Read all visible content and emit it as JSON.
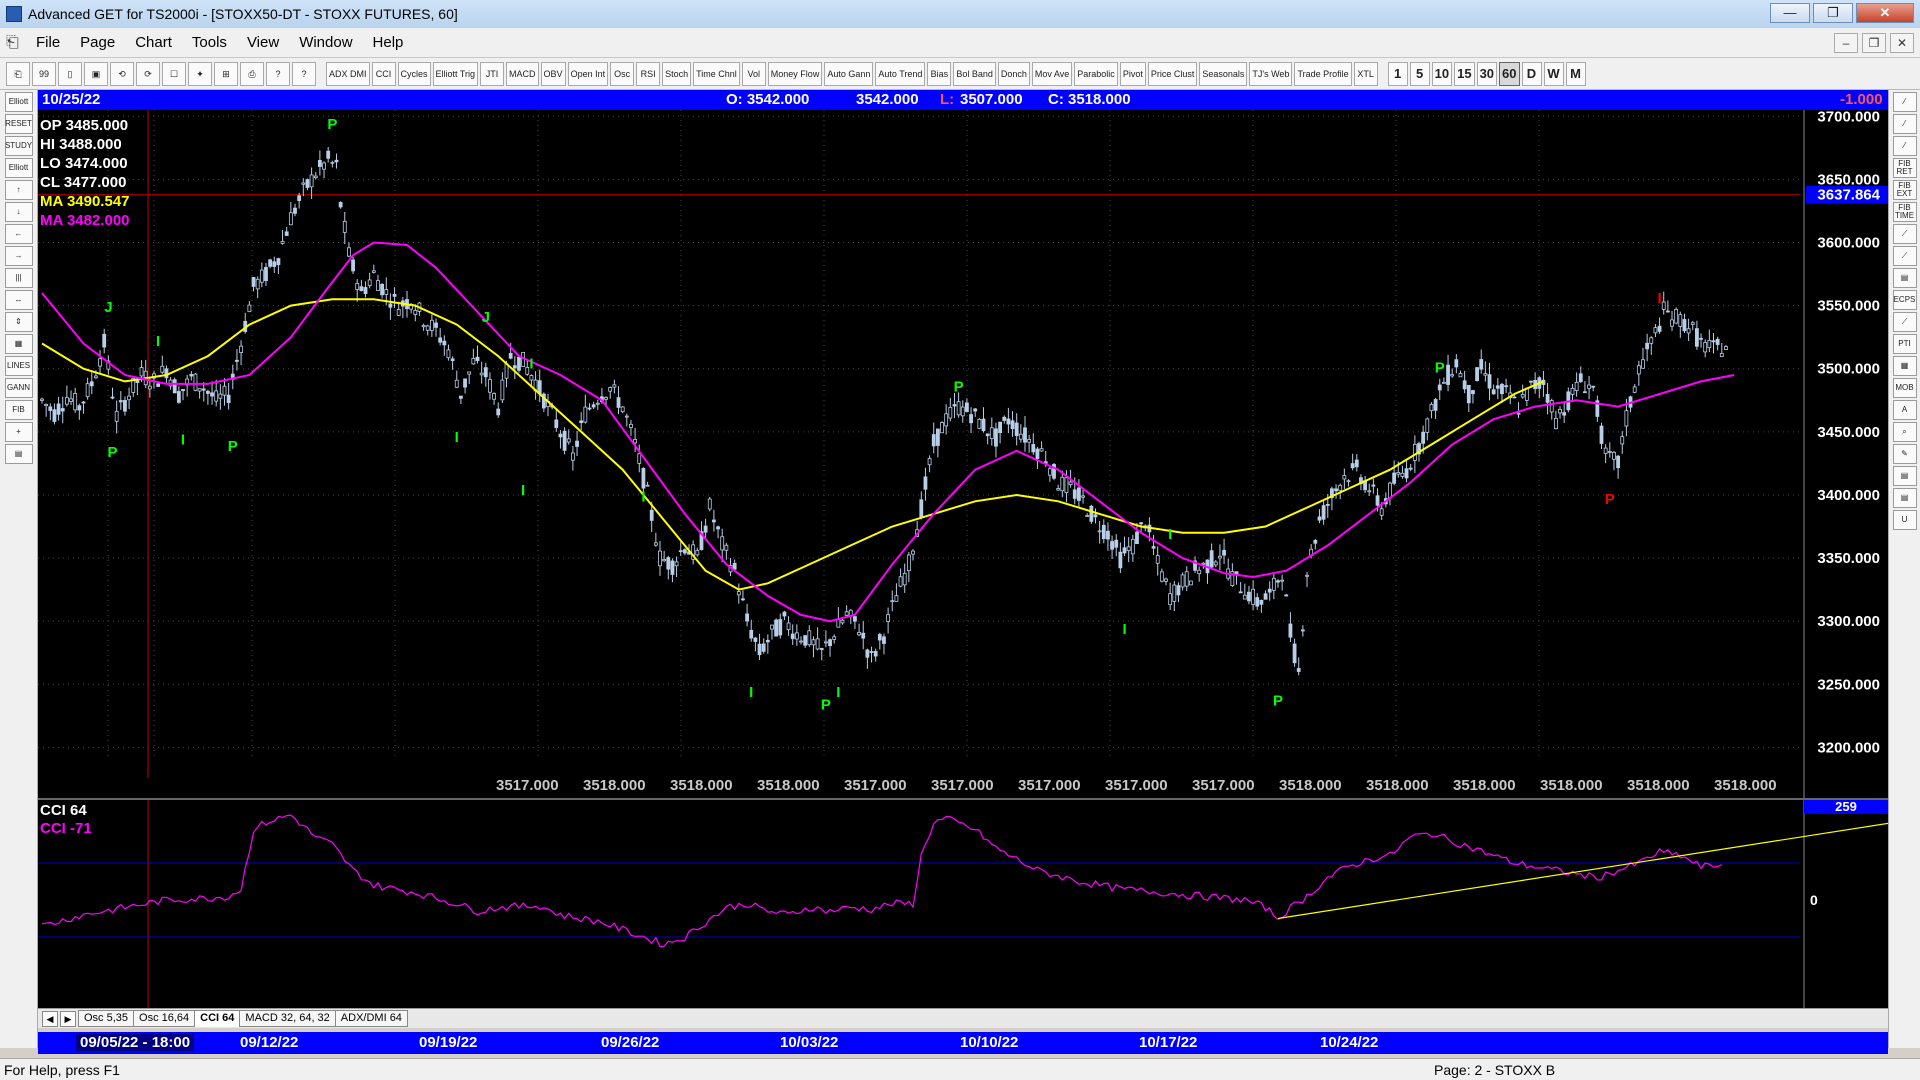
{
  "window": {
    "title": "Advanced GET for TS2000i - [STOXX50-DT - STOXX FUTURES, 60]",
    "minimize": "—",
    "maximize": "❐",
    "close": "✕"
  },
  "menu": [
    "File",
    "Page",
    "Chart",
    "Tools",
    "View",
    "Window",
    "Help"
  ],
  "mdi_buttons": [
    "–",
    "❐",
    "✕"
  ],
  "toolbar": {
    "file_buttons": [
      "⎗",
      "99",
      "▯",
      "▣",
      "⟲",
      "⟳",
      "☐",
      "✦",
      "⊞",
      "⎙",
      "?",
      "?"
    ],
    "studies": [
      "ADX DMI",
      "CCI",
      "Cycles",
      "Elliott Trig",
      "JTI",
      "MACD",
      "OBV",
      "Open Int",
      "Osc",
      "RSI",
      "Stoch",
      "Time Chnl",
      "Vol",
      "Money Flow",
      "Auto Gann",
      "Auto Trend",
      "Bias",
      "Bol Band",
      "Donch",
      "Mov Ave",
      "Parabolic",
      "Pivot",
      "Price Clust",
      "Seasonals",
      "TJ's Web",
      "Trade Profile",
      "XTL"
    ],
    "periods": [
      "1",
      "5",
      "10",
      "15",
      "30",
      "60",
      "D",
      "W",
      "M"
    ],
    "active_period": "60"
  },
  "left_tools": [
    "Elliott",
    "RESET",
    "STUDY",
    "Elliott",
    "↑",
    "↓",
    "←",
    "→",
    "|||",
    "↔",
    "⇕",
    "▦",
    "LINES",
    "GANN",
    "FIB",
    "+",
    "▤"
  ],
  "right_tools": [
    "⁄",
    "⁄",
    "⁄",
    "FIB RET",
    "FIB EXT",
    "FIB TIME",
    "⟋",
    "⟋",
    "▤",
    "ECPS",
    "⟋",
    "PTI",
    "▦",
    "MOB",
    "A",
    "⌕",
    "✎",
    "▤",
    "▤",
    "U"
  ],
  "infobar": {
    "date": "10/25/22",
    "open": "O: 3542.000",
    "high": "3542.000",
    "low_label": "L:",
    "low": "3507.000",
    "close": "C: 3518.000",
    "change": "-1.000"
  },
  "chart_data": {
    "type": "candlestick",
    "symbol": "STOXX50-DT",
    "interval": "60",
    "ylim": [
      3190,
      3705
    ],
    "yticks": [
      "3700.000",
      "3650.000",
      "3600.000",
      "3550.000",
      "3500.000",
      "3450.000",
      "3400.000",
      "3350.000",
      "3300.000",
      "3250.000",
      "3200.000"
    ],
    "hline": {
      "value": 3637.864,
      "label": "3637.864"
    },
    "legend": [
      {
        "key": "OP",
        "value": "3485.000",
        "color": "#ffffff"
      },
      {
        "key": "HI",
        "value": "3488.000",
        "color": "#ffffff"
      },
      {
        "key": "LO",
        "value": "3474.000",
        "color": "#ffffff"
      },
      {
        "key": "CL",
        "value": "3477.000",
        "color": "#ffffff"
      },
      {
        "key": "MA",
        "value": "3490.547",
        "color": "#ffff00"
      },
      {
        "key": "MA",
        "value": "3482.000",
        "color": "#ff00ff"
      }
    ],
    "price_path": [
      [
        0,
        3475
      ],
      [
        3,
        3465
      ],
      [
        6,
        3478
      ],
      [
        9,
        3470
      ],
      [
        12,
        3488
      ],
      [
        15,
        3520
      ],
      [
        18,
        3462
      ],
      [
        21,
        3480
      ],
      [
        24,
        3495
      ],
      [
        27,
        3490
      ],
      [
        30,
        3500
      ],
      [
        33,
        3480
      ],
      [
        36,
        3492
      ],
      [
        39,
        3485
      ],
      [
        42,
        3475
      ],
      [
        45,
        3480
      ],
      [
        48,
        3520
      ],
      [
        51,
        3565
      ],
      [
        54,
        3575
      ],
      [
        57,
        3590
      ],
      [
        60,
        3620
      ],
      [
        63,
        3640
      ],
      [
        66,
        3655
      ],
      [
        69,
        3665
      ],
      [
        71,
        3660
      ],
      [
        72,
        3630
      ],
      [
        74,
        3590
      ],
      [
        77,
        3560
      ],
      [
        80,
        3575
      ],
      [
        83,
        3560
      ],
      [
        86,
        3550
      ],
      [
        89,
        3555
      ],
      [
        92,
        3540
      ],
      [
        95,
        3530
      ],
      [
        98,
        3515
      ],
      [
        101,
        3480
      ],
      [
        104,
        3505
      ],
      [
        107,
        3495
      ],
      [
        110,
        3470
      ],
      [
        113,
        3510
      ],
      [
        116,
        3505
      ],
      [
        119,
        3490
      ],
      [
        122,
        3470
      ],
      [
        125,
        3450
      ],
      [
        128,
        3430
      ],
      [
        131,
        3465
      ],
      [
        134,
        3478
      ],
      [
        137,
        3485
      ],
      [
        140,
        3470
      ],
      [
        143,
        3440
      ],
      [
        146,
        3400
      ],
      [
        149,
        3350
      ],
      [
        152,
        3345
      ],
      [
        155,
        3360
      ],
      [
        158,
        3350
      ],
      [
        161,
        3390
      ],
      [
        164,
        3360
      ],
      [
        167,
        3340
      ],
      [
        170,
        3300
      ],
      [
        173,
        3275
      ],
      [
        176,
        3290
      ],
      [
        179,
        3300
      ],
      [
        182,
        3290
      ],
      [
        185,
        3285
      ],
      [
        188,
        3275
      ],
      [
        191,
        3290
      ],
      [
        194,
        3305
      ],
      [
        197,
        3295
      ],
      [
        200,
        3270
      ],
      [
        203,
        3290
      ],
      [
        206,
        3320
      ],
      [
        209,
        3345
      ],
      [
        212,
        3390
      ],
      [
        215,
        3440
      ],
      [
        218,
        3460
      ],
      [
        221,
        3470
      ],
      [
        224,
        3465
      ],
      [
        227,
        3455
      ],
      [
        230,
        3445
      ],
      [
        233,
        3460
      ],
      [
        236,
        3450
      ],
      [
        239,
        3440
      ],
      [
        242,
        3430
      ],
      [
        245,
        3410
      ],
      [
        248,
        3405
      ],
      [
        251,
        3395
      ],
      [
        254,
        3380
      ],
      [
        257,
        3370
      ],
      [
        260,
        3350
      ],
      [
        263,
        3360
      ],
      [
        266,
        3380
      ],
      [
        269,
        3345
      ],
      [
        272,
        3320
      ],
      [
        275,
        3330
      ],
      [
        278,
        3340
      ],
      [
        281,
        3345
      ],
      [
        284,
        3355
      ],
      [
        287,
        3335
      ],
      [
        290,
        3325
      ],
      [
        293,
        3315
      ],
      [
        296,
        3320
      ],
      [
        299,
        3340
      ],
      [
        301,
        3290
      ],
      [
        303,
        3260
      ],
      [
        305,
        3340
      ],
      [
        308,
        3380
      ],
      [
        311,
        3400
      ],
      [
        314,
        3415
      ],
      [
        317,
        3420
      ],
      [
        320,
        3405
      ],
      [
        323,
        3390
      ],
      [
        326,
        3410
      ],
      [
        329,
        3420
      ],
      [
        332,
        3440
      ],
      [
        335,
        3465
      ],
      [
        338,
        3490
      ],
      [
        341,
        3505
      ],
      [
        344,
        3480
      ],
      [
        347,
        3500
      ],
      [
        350,
        3485
      ],
      [
        353,
        3480
      ],
      [
        356,
        3470
      ],
      [
        359,
        3485
      ],
      [
        362,
        3490
      ],
      [
        365,
        3460
      ],
      [
        368,
        3475
      ],
      [
        371,
        3490
      ],
      [
        374,
        3485
      ],
      [
        377,
        3430
      ],
      [
        380,
        3425
      ],
      [
        382,
        3460
      ],
      [
        385,
        3500
      ],
      [
        388,
        3520
      ],
      [
        391,
        3545
      ],
      [
        394,
        3540
      ],
      [
        397,
        3535
      ],
      [
        400,
        3520
      ],
      [
        403,
        3515
      ],
      [
        406,
        3518
      ]
    ],
    "ma_yellow": [
      [
        0,
        3520
      ],
      [
        10,
        3500
      ],
      [
        20,
        3490
      ],
      [
        30,
        3495
      ],
      [
        40,
        3510
      ],
      [
        50,
        3535
      ],
      [
        60,
        3550
      ],
      [
        70,
        3555
      ],
      [
        80,
        3555
      ],
      [
        90,
        3550
      ],
      [
        100,
        3535
      ],
      [
        110,
        3510
      ],
      [
        120,
        3480
      ],
      [
        130,
        3450
      ],
      [
        140,
        3420
      ],
      [
        150,
        3380
      ],
      [
        160,
        3340
      ],
      [
        168,
        3325
      ],
      [
        175,
        3330
      ],
      [
        185,
        3345
      ],
      [
        195,
        3360
      ],
      [
        205,
        3375
      ],
      [
        215,
        3385
      ],
      [
        225,
        3395
      ],
      [
        235,
        3400
      ],
      [
        245,
        3395
      ],
      [
        255,
        3385
      ],
      [
        265,
        3375
      ],
      [
        275,
        3370
      ],
      [
        285,
        3370
      ],
      [
        295,
        3375
      ],
      [
        305,
        3390
      ],
      [
        315,
        3405
      ],
      [
        325,
        3420
      ],
      [
        335,
        3440
      ],
      [
        345,
        3460
      ],
      [
        355,
        3480
      ],
      [
        362,
        3490
      ]
    ],
    "ma_magenta": [
      [
        0,
        3560
      ],
      [
        10,
        3520
      ],
      [
        20,
        3495
      ],
      [
        30,
        3488
      ],
      [
        40,
        3488
      ],
      [
        50,
        3495
      ],
      [
        60,
        3525
      ],
      [
        68,
        3560
      ],
      [
        75,
        3590
      ],
      [
        80,
        3600
      ],
      [
        88,
        3598
      ],
      [
        95,
        3580
      ],
      [
        105,
        3545
      ],
      [
        115,
        3510
      ],
      [
        125,
        3495
      ],
      [
        135,
        3475
      ],
      [
        145,
        3430
      ],
      [
        155,
        3385
      ],
      [
        165,
        3345
      ],
      [
        175,
        3320
      ],
      [
        183,
        3305
      ],
      [
        190,
        3300
      ],
      [
        196,
        3305
      ],
      [
        205,
        3345
      ],
      [
        215,
        3385
      ],
      [
        225,
        3420
      ],
      [
        235,
        3435
      ],
      [
        245,
        3420
      ],
      [
        255,
        3395
      ],
      [
        265,
        3370
      ],
      [
        275,
        3350
      ],
      [
        285,
        3338
      ],
      [
        292,
        3335
      ],
      [
        300,
        3340
      ],
      [
        310,
        3360
      ],
      [
        320,
        3385
      ],
      [
        330,
        3410
      ],
      [
        340,
        3440
      ],
      [
        350,
        3460
      ],
      [
        360,
        3470
      ],
      [
        370,
        3475
      ],
      [
        380,
        3470
      ],
      [
        390,
        3480
      ],
      [
        400,
        3490
      ],
      [
        408,
        3495
      ]
    ],
    "cycle_labels": [
      {
        "t": "J",
        "i": 16,
        "p": 3545,
        "color": "#00ff00"
      },
      {
        "t": "P",
        "i": 17,
        "p": 3430,
        "color": "#00ff00"
      },
      {
        "t": "I",
        "i": 28,
        "p": 3518,
        "color": "#00ff00"
      },
      {
        "t": "I",
        "i": 34,
        "p": 3440,
        "color": "#00ff00"
      },
      {
        "t": "P",
        "i": 46,
        "p": 3435,
        "color": "#00ff00"
      },
      {
        "t": "P",
        "i": 70,
        "p": 3690,
        "color": "#00ff00"
      },
      {
        "t": "J",
        "i": 107,
        "p": 3537,
        "color": "#00ff00"
      },
      {
        "t": "I",
        "i": 100,
        "p": 3442,
        "color": "#00ff00"
      },
      {
        "t": "I",
        "i": 118,
        "p": 3500,
        "color": "#00ff00"
      },
      {
        "t": "I",
        "i": 116,
        "p": 3400,
        "color": "#00ff00"
      },
      {
        "t": "I",
        "i": 145,
        "p": 3395,
        "color": "#00ff00"
      },
      {
        "t": "I",
        "i": 171,
        "p": 3240,
        "color": "#00ff00"
      },
      {
        "t": "P",
        "i": 189,
        "p": 3230,
        "color": "#00ff00"
      },
      {
        "t": "I",
        "i": 192,
        "p": 3240,
        "color": "#00ff00"
      },
      {
        "t": "P",
        "i": 221,
        "p": 3482,
        "color": "#00ff00"
      },
      {
        "t": "I",
        "i": 261,
        "p": 3290,
        "color": "#00ff00"
      },
      {
        "t": "I",
        "i": 272,
        "p": 3365,
        "color": "#00ff00"
      },
      {
        "t": "P",
        "i": 298,
        "p": 3233,
        "color": "#00ff00"
      },
      {
        "t": "P",
        "i": 337,
        "p": 3497,
        "color": "#00ff00"
      },
      {
        "t": "P",
        "i": 378,
        "p": 3393,
        "color": "#ff0000"
      },
      {
        "t": "I",
        "i": 390,
        "p": 3552,
        "color": "#ff0000"
      }
    ],
    "x_price_labels": [
      "3517.000",
      "3518.000",
      "3518.000",
      "3518.000",
      "3517.000",
      "3517.000",
      "3517.000",
      "3517.000",
      "3517.000",
      "3518.000",
      "3518.000",
      "3518.000",
      "3518.000",
      "3518.000",
      "3518.000"
    ],
    "dates": [
      "09/05/22 - 18:00",
      "09/12/22",
      "09/19/22",
      "09/26/22",
      "10/03/22",
      "10/10/22",
      "10/17/22",
      "10/24/22"
    ]
  },
  "cci_panel": {
    "title": "CCI 64",
    "value_label": "CCI  -71",
    "top_badge": "259",
    "zero_label": "0",
    "cci_path": [
      [
        0,
        -70
      ],
      [
        10,
        -40
      ],
      [
        20,
        -20
      ],
      [
        30,
        0
      ],
      [
        40,
        5
      ],
      [
        45,
        10
      ],
      [
        48,
        30
      ],
      [
        51,
        190
      ],
      [
        54,
        210
      ],
      [
        57,
        220
      ],
      [
        60,
        230
      ],
      [
        63,
        200
      ],
      [
        66,
        170
      ],
      [
        70,
        150
      ],
      [
        75,
        80
      ],
      [
        80,
        40
      ],
      [
        90,
        20
      ],
      [
        100,
        -10
      ],
      [
        105,
        -30
      ],
      [
        110,
        -20
      ],
      [
        120,
        -15
      ],
      [
        125,
        -40
      ],
      [
        130,
        -50
      ],
      [
        135,
        -60
      ],
      [
        140,
        -80
      ],
      [
        145,
        -100
      ],
      [
        150,
        -120
      ],
      [
        155,
        -100
      ],
      [
        160,
        -60
      ],
      [
        165,
        -20
      ],
      [
        170,
        -10
      ],
      [
        175,
        -30
      ],
      [
        180,
        -40
      ],
      [
        185,
        -20
      ],
      [
        190,
        -30
      ],
      [
        195,
        -20
      ],
      [
        200,
        -25
      ],
      [
        205,
        -10
      ],
      [
        210,
        -10
      ],
      [
        212,
        120
      ],
      [
        215,
        210
      ],
      [
        218,
        220
      ],
      [
        225,
        190
      ],
      [
        230,
        140
      ],
      [
        235,
        110
      ],
      [
        240,
        80
      ],
      [
        250,
        50
      ],
      [
        260,
        30
      ],
      [
        270,
        20
      ],
      [
        280,
        10
      ],
      [
        290,
        0
      ],
      [
        295,
        -20
      ],
      [
        298,
        -50
      ],
      [
        300,
        -30
      ],
      [
        305,
        10
      ],
      [
        310,
        60
      ],
      [
        315,
        90
      ],
      [
        320,
        110
      ],
      [
        325,
        120
      ],
      [
        330,
        170
      ],
      [
        335,
        180
      ],
      [
        340,
        160
      ],
      [
        345,
        140
      ],
      [
        350,
        120
      ],
      [
        355,
        100
      ],
      [
        360,
        90
      ],
      [
        365,
        80
      ],
      [
        370,
        70
      ],
      [
        375,
        60
      ],
      [
        380,
        80
      ],
      [
        385,
        100
      ],
      [
        390,
        130
      ],
      [
        395,
        120
      ],
      [
        400,
        90
      ],
      [
        405,
        95
      ]
    ],
    "trendline": [
      [
        298,
        -50
      ],
      [
        410,
        105
      ]
    ]
  },
  "indicator_tabs": [
    "Osc 5,35",
    "Osc 16,64",
    "CCI 64",
    "MACD 32, 64, 32",
    "ADX/DMI 64"
  ],
  "active_tab": "CCI 64",
  "status": {
    "help": "For Help, press F1",
    "page": "Page: 2 - STOXX B"
  }
}
